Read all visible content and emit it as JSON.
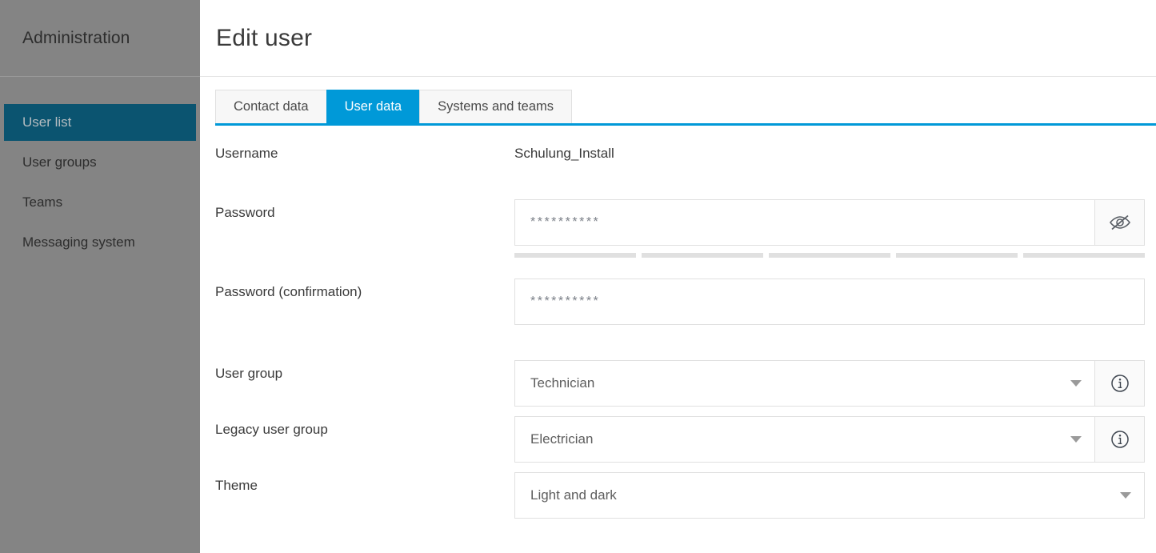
{
  "sidebar": {
    "title": "Administration",
    "items": [
      {
        "label": "User list",
        "active": true
      },
      {
        "label": "User groups",
        "active": false
      },
      {
        "label": "Teams",
        "active": false
      },
      {
        "label": "Messaging system",
        "active": false
      }
    ]
  },
  "header": {
    "title": "Edit user"
  },
  "tabs": [
    {
      "label": "Contact data",
      "active": false
    },
    {
      "label": "User data",
      "active": true
    },
    {
      "label": "Systems and teams",
      "active": false
    }
  ],
  "form": {
    "username": {
      "label": "Username",
      "value": "Schulung_Install"
    },
    "password": {
      "label": "Password",
      "value": "**********",
      "toggle_icon": "eye-slash-icon",
      "strength_segments": 5
    },
    "password_confirmation": {
      "label": "Password (confirmation)",
      "value": "**********"
    },
    "user_group": {
      "label": "User group",
      "value": "Technician",
      "info_icon": "info-circle-icon"
    },
    "legacy_user_group": {
      "label": "Legacy user group",
      "value": "Electrician",
      "info_icon": "info-circle-icon"
    },
    "theme": {
      "label": "Theme",
      "value": "Light and dark"
    }
  },
  "colors": {
    "sidebar_bg": "#848484",
    "sidebar_active": "#0b5470",
    "accent": "#0099d8",
    "field_border": "#e0e0e0",
    "meter_empty": "#e0e0e0"
  }
}
